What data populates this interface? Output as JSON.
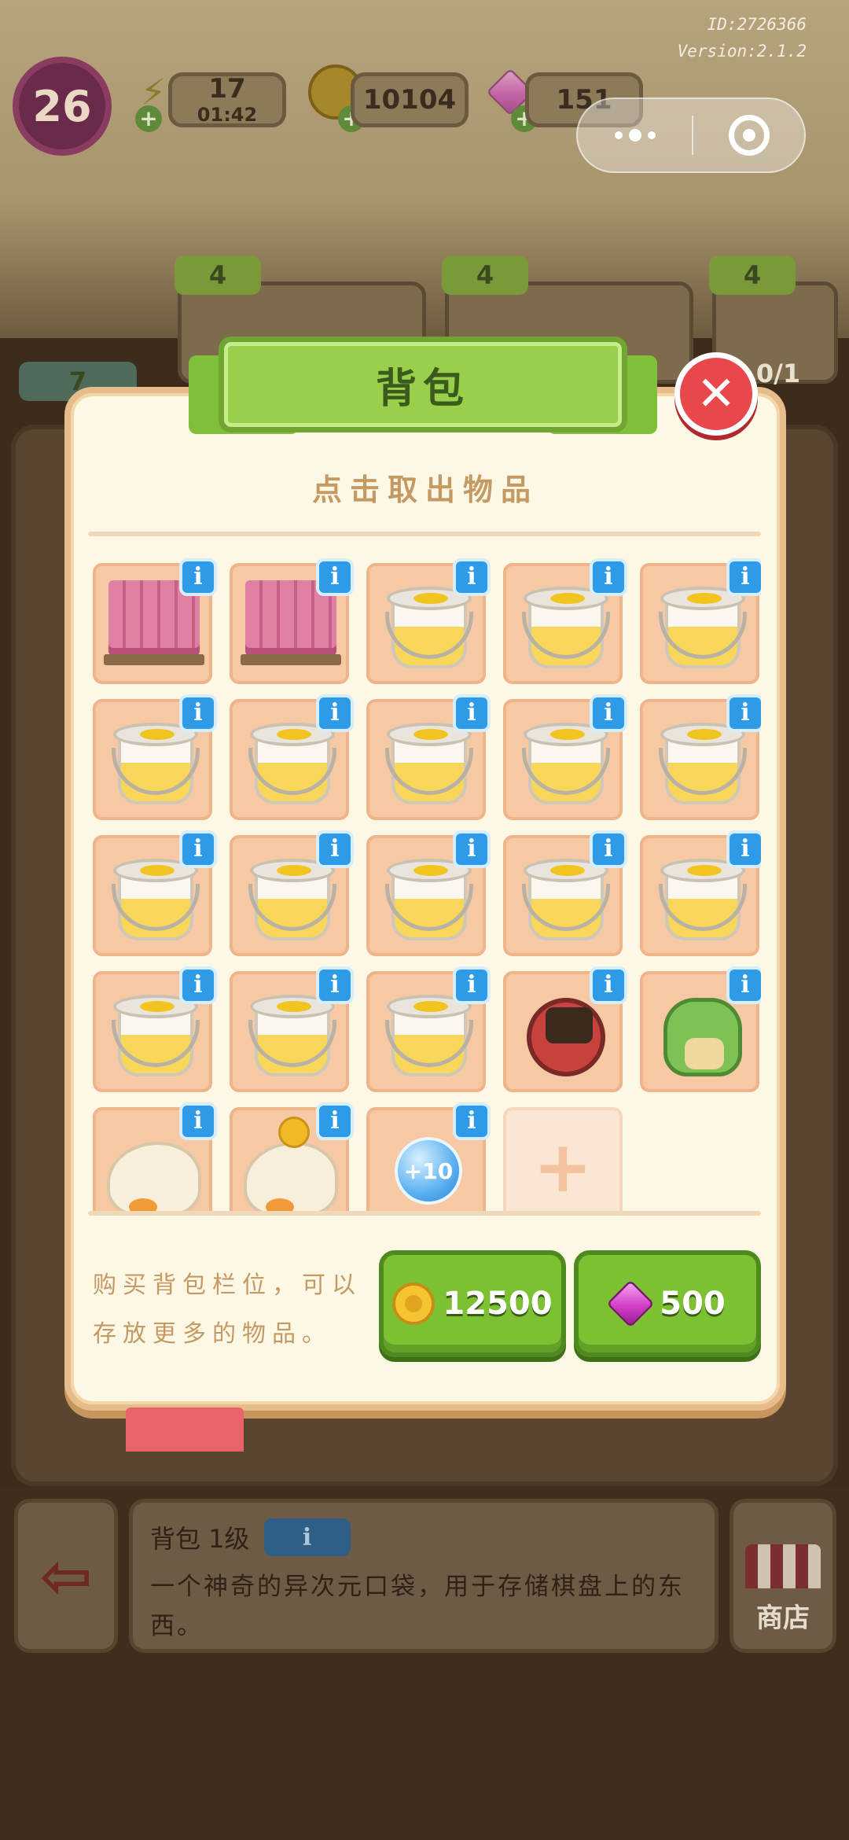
{
  "hud": {
    "level": "26",
    "energy_value": "17",
    "energy_timer": "01:42",
    "coins": "10104",
    "gems": "151",
    "plus": "+"
  },
  "build_info": {
    "id": "ID:2726366",
    "version": "Version:2.1.2"
  },
  "orders": {
    "tag_values": [
      "4",
      "4",
      "4"
    ],
    "left_count": "7",
    "right_progress": "0/1"
  },
  "modal": {
    "title": "背包",
    "close_label": "✕",
    "subtitle": "点击取出物品",
    "info_glyph": "i",
    "plus_glyph": "+",
    "slots": [
      {
        "item": "brick-pallet",
        "label": ""
      },
      {
        "item": "brick-pallet",
        "label": ""
      },
      {
        "item": "paint-bucket",
        "label": ""
      },
      {
        "item": "paint-bucket",
        "label": ""
      },
      {
        "item": "paint-bucket",
        "label": ""
      },
      {
        "item": "paint-bucket",
        "label": ""
      },
      {
        "item": "paint-bucket",
        "label": ""
      },
      {
        "item": "paint-bucket",
        "label": ""
      },
      {
        "item": "paint-bucket",
        "label": ""
      },
      {
        "item": "paint-bucket",
        "label": ""
      },
      {
        "item": "paint-bucket",
        "label": ""
      },
      {
        "item": "paint-bucket",
        "label": ""
      },
      {
        "item": "paint-bucket",
        "label": ""
      },
      {
        "item": "paint-bucket",
        "label": ""
      },
      {
        "item": "paint-bucket",
        "label": ""
      },
      {
        "item": "paint-bucket",
        "label": ""
      },
      {
        "item": "paint-bucket",
        "label": ""
      },
      {
        "item": "paint-bucket",
        "label": ""
      },
      {
        "item": "gadget-device",
        "label": ""
      },
      {
        "item": "dino-toy",
        "label": ""
      },
      {
        "item": "duck-egg",
        "label": ""
      },
      {
        "item": "duck-egg-coin",
        "label": ""
      },
      {
        "item": "bonus-bubble",
        "label": "+10"
      },
      {
        "item": "empty-slot",
        "label": ""
      }
    ],
    "buy_text": "购买背包栏位，可以存放更多的物品。",
    "buy_coin_price": "12500",
    "buy_gem_price": "500"
  },
  "info_panel": {
    "title": "背包 1级",
    "info_glyph": "i",
    "description": "一个神奇的异次元口袋，用于存储棋盘上的东西。"
  },
  "shop_label": "商店",
  "colors": {
    "modal_bg": "#fdf7e6",
    "title_green": "#98d04c",
    "slot_peach": "#f6c8a4",
    "info_blue": "#2d9be8",
    "close_red": "#e8474c",
    "buy_green": "#7cc132"
  }
}
